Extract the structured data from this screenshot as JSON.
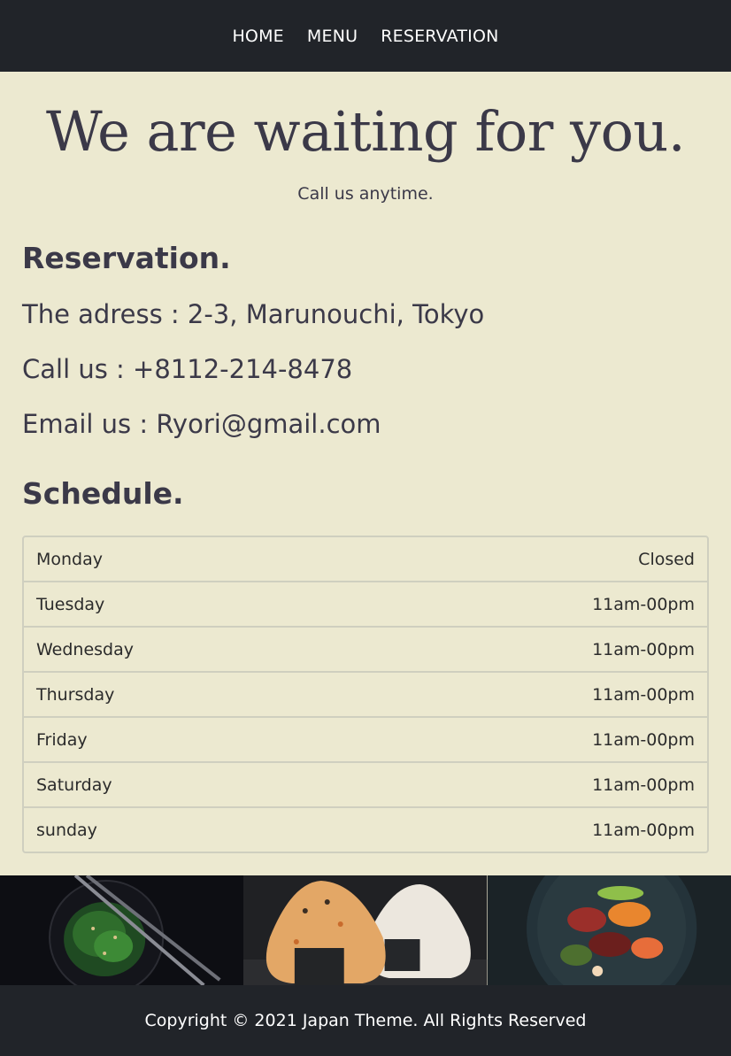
{
  "nav": {
    "items": [
      {
        "label": "HOME"
      },
      {
        "label": "MENU"
      },
      {
        "label": "RESERVATION"
      }
    ]
  },
  "hero": {
    "title": "We are waiting for you.",
    "subtitle": "Call us anytime."
  },
  "reservation": {
    "heading": "Reservation.",
    "address": "The adress : 2-3, Marunouchi, Tokyo",
    "phone": "Call us : +8112-214-8478",
    "email": "Email us : Ryori@gmail.com"
  },
  "schedule": {
    "heading": "Schedule.",
    "rows": [
      {
        "day": "Monday",
        "hours": "Closed"
      },
      {
        "day": "Tuesday",
        "hours": "11am-00pm"
      },
      {
        "day": "Wednesday",
        "hours": "11am-00pm"
      },
      {
        "day": "Thursday",
        "hours": "11am-00pm"
      },
      {
        "day": "Friday",
        "hours": "11am-00pm"
      },
      {
        "day": "Saturday",
        "hours": "11am-00pm"
      },
      {
        "day": "sunday",
        "hours": "11am-00pm"
      }
    ]
  },
  "gallery": {
    "images": [
      {
        "subject": "seaweed-salad-bowl-image"
      },
      {
        "subject": "onigiri-rice-balls-image"
      },
      {
        "subject": "sashimi-bowl-image"
      }
    ]
  },
  "footer": {
    "copyright": "Copyright © 2021 Japan Theme. All Rights Reserved"
  },
  "colors": {
    "background": "#ece9d0",
    "navbar": "#212429",
    "text": "#3b3948",
    "border": "#cfcfbf"
  }
}
